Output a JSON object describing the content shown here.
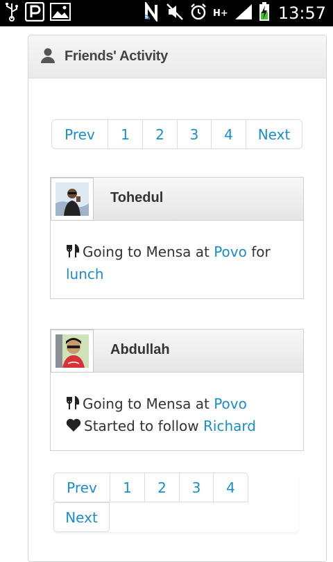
{
  "status_bar": {
    "time": "13:57",
    "network": "H+"
  },
  "panel": {
    "title": "Friends' Activity"
  },
  "pagination_top": {
    "prev": "Prev",
    "pages": [
      "1",
      "2",
      "3",
      "4"
    ],
    "next": "Next"
  },
  "pagination_bottom": {
    "prev": "Prev",
    "pages": [
      "1",
      "2",
      "3",
      "4"
    ],
    "next": "Next"
  },
  "activities": [
    {
      "name": "Tohedul",
      "line1": {
        "text_a": "Going to Mensa at ",
        "link_a": "Povo",
        "text_b": " for ",
        "link_b": "lunch"
      }
    },
    {
      "name": "Abdullah",
      "line1": {
        "text_a": "Going to Mensa at ",
        "link_a": "Povo"
      },
      "line2": {
        "text_a": "Started to follow ",
        "link_a": "Richard"
      }
    }
  ]
}
